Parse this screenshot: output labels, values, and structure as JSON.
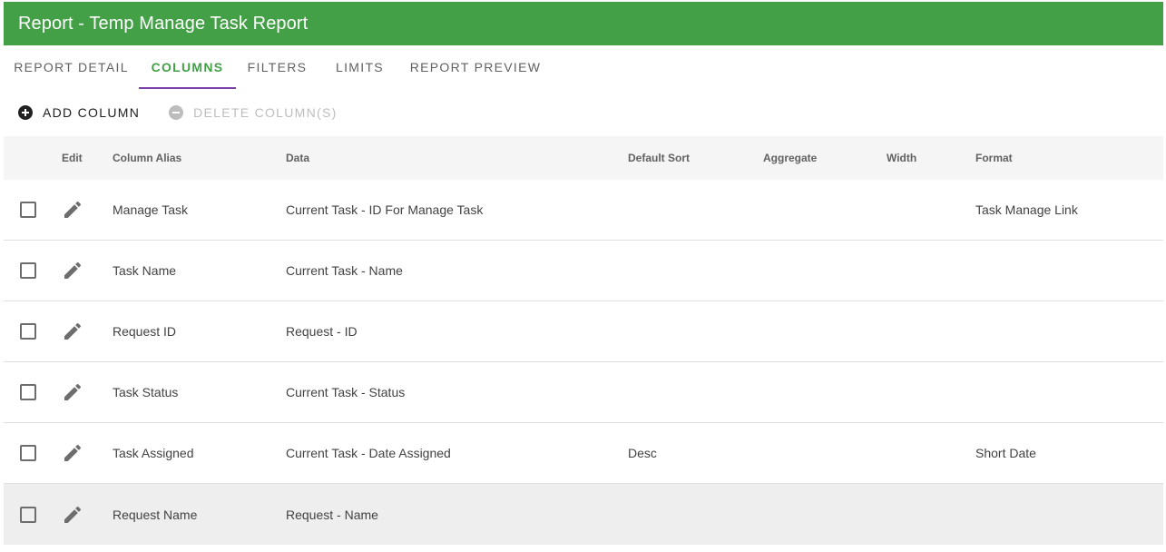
{
  "header": {
    "title": "Report - Temp Manage Task Report"
  },
  "tabs": [
    {
      "label": "REPORT DETAIL",
      "active": false
    },
    {
      "label": "COLUMNS",
      "active": true
    },
    {
      "label": "FILTERS",
      "active": false
    },
    {
      "label": "LIMITS",
      "active": false
    },
    {
      "label": "REPORT PREVIEW",
      "active": false
    }
  ],
  "toolbar": {
    "add_label": "ADD COLUMN",
    "delete_label": "DELETE COLUMN(S)",
    "delete_disabled": true
  },
  "table": {
    "headers": {
      "edit": "Edit",
      "alias": "Column Alias",
      "data": "Data",
      "sort": "Default Sort",
      "aggregate": "Aggregate",
      "width": "Width",
      "format": "Format"
    },
    "rows": [
      {
        "alias": "Manage Task",
        "data": "Current Task - ID For Manage Task",
        "sort": "",
        "aggregate": "",
        "width": "",
        "format": "Task Manage Link",
        "checked": false
      },
      {
        "alias": "Task Name",
        "data": "Current Task - Name",
        "sort": "",
        "aggregate": "",
        "width": "",
        "format": "",
        "checked": false
      },
      {
        "alias": "Request ID",
        "data": "Request - ID",
        "sort": "",
        "aggregate": "",
        "width": "",
        "format": "",
        "checked": false
      },
      {
        "alias": "Task Status",
        "data": "Current Task - Status",
        "sort": "",
        "aggregate": "",
        "width": "",
        "format": "",
        "checked": false
      },
      {
        "alias": "Task Assigned",
        "data": "Current Task - Date Assigned",
        "sort": "Desc",
        "aggregate": "",
        "width": "",
        "format": "Short Date",
        "checked": false
      },
      {
        "alias": "Request Name",
        "data": "Request - Name",
        "sort": "",
        "aggregate": "",
        "width": "",
        "format": "",
        "checked": false,
        "highlighted": true
      }
    ]
  },
  "icons": {
    "add": "plus-circle-icon",
    "delete": "minus-circle-icon",
    "edit": "pencil-icon"
  },
  "colors": {
    "header_bg": "#43a047",
    "active_tab_text": "#43a047",
    "active_tab_indicator": "#7b3fa8",
    "disabled_text": "#bdbdbd",
    "table_header_bg": "#f5f5f5",
    "row_highlight_bg": "#eeeeee"
  }
}
